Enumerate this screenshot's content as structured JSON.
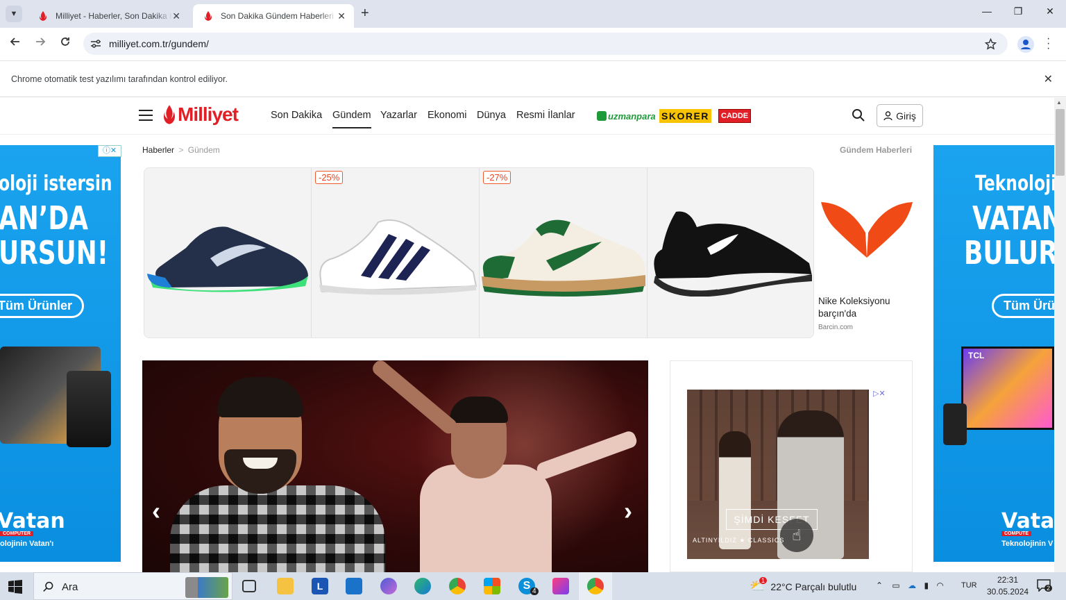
{
  "browser": {
    "tabs": [
      {
        "title": "Milliyet - Haberler, Son Dakika Haberleri",
        "active": false
      },
      {
        "title": "Son Dakika Gündem Haberleri",
        "active": true
      }
    ],
    "new_tab_symbol": "+",
    "url": "milliyet.com.tr/gundem/",
    "infobar_text": "Chrome otomatik test yazılımı tarafından kontrol ediliyor.",
    "close_symbol": "✕",
    "window_controls": {
      "minimize": "—",
      "restore": "❐",
      "close": "✕"
    }
  },
  "site": {
    "logo_text": "Milliyet",
    "nav": [
      {
        "label": "Son Dakika",
        "active": false
      },
      {
        "label": "Gündem",
        "active": true
      },
      {
        "label": "Yazarlar",
        "active": false
      },
      {
        "label": "Ekonomi",
        "active": false
      },
      {
        "label": "Dünya",
        "active": false
      },
      {
        "label": "Resmi İlanlar",
        "active": false
      }
    ],
    "partners": {
      "uzmanpara": "uzmanpara",
      "skorer": "SKORER",
      "cadde": "CADDE"
    },
    "login_label": "Giriş",
    "breadcrumb": {
      "root": "Haberler",
      "separator": ">",
      "current": "Gündem"
    },
    "section_label": "Gündem Haberleri"
  },
  "side_ads": {
    "left": {
      "lines": [
        "oloji istersin",
        "AN’DA",
        "URSUN!"
      ],
      "cta": "Tüm Ürünler",
      "brand": "Vatan",
      "brand_sub": "COMPUTER",
      "tagline": "olojinin Vatan'ı"
    },
    "right": {
      "lines": [
        "Teknoloji is",
        "VATAN",
        "BULURS"
      ],
      "cta": "Tüm Ürün",
      "brand": "Vata",
      "brand_sub": "COMPUTE",
      "tagline": "Teknolojinin V",
      "tv_brand": "TCL"
    }
  },
  "shoe_ad": {
    "cards": [
      {
        "badge": "",
        "colors": [
          "#24304a",
          "#3ee07a",
          "#1e7fd6"
        ]
      },
      {
        "badge": "-25%",
        "colors": [
          "#ffffff",
          "#1d2352",
          "#dcdcdc"
        ]
      },
      {
        "badge": "-27%",
        "colors": [
          "#f4eee2",
          "#1f6b35",
          "#c79a63"
        ]
      },
      {
        "badge": "",
        "colors": [
          "#121212",
          "#ffffff",
          "#2a2a2a"
        ]
      }
    ],
    "brand_name": "Nike Koleksiyonu barçın'da",
    "brand_site": "Barcin.com",
    "brand_color": "#f04b16"
  },
  "hero": {
    "prev_symbol": "‹",
    "next_symbol": "›"
  },
  "rail_ad": {
    "cta": "ŞİMDİ KEŞFET",
    "footer": "ALTINYILDIZ ★ CLASSICS"
  },
  "taskbar": {
    "search_label": "Ara",
    "weather": "22°C  Parçalı bulutlu",
    "weather_badge": "1",
    "language": "TUR",
    "time": "22:31",
    "date": "30.05.2024",
    "notifications": "2",
    "skype_badge": "4"
  },
  "colors": {
    "brand_red": "#e11f26",
    "vatan_blue": "#0a8fe0",
    "taskbar": "#d6dfea"
  }
}
